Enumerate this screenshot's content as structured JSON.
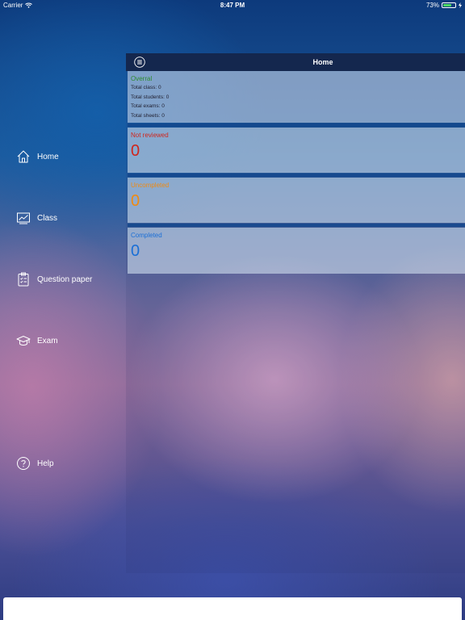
{
  "status_bar": {
    "carrier": "Carrier",
    "time": "8:47 PM",
    "battery": "73%",
    "battery_level": 0.73
  },
  "sidebar": {
    "items": [
      {
        "label": "Home",
        "icon": "home-icon"
      },
      {
        "label": "Class",
        "icon": "chart-icon"
      },
      {
        "label": "Question paper",
        "icon": "clipboard-icon"
      },
      {
        "label": "Exam",
        "icon": "graduation-cap-icon"
      },
      {
        "label": "Help",
        "icon": "help-icon"
      }
    ]
  },
  "navbar": {
    "title": "Home",
    "menu_icon": "hamburger-menu-icon"
  },
  "overall": {
    "title": "Overral",
    "stats": [
      "Total class: 0",
      "Total students: 0",
      "Total exams: 0",
      "Total sheets: 0"
    ]
  },
  "cards": [
    {
      "title": "Not reviewed",
      "value": "0",
      "color": "#d0261c"
    },
    {
      "title": "Uncompleted",
      "value": "0",
      "color": "#f08a12"
    },
    {
      "title": "Completed",
      "value": "0",
      "color": "#1a6fd6"
    }
  ],
  "colors": {
    "overall_title": "#2e8b2e",
    "navbar": "#14274e"
  }
}
